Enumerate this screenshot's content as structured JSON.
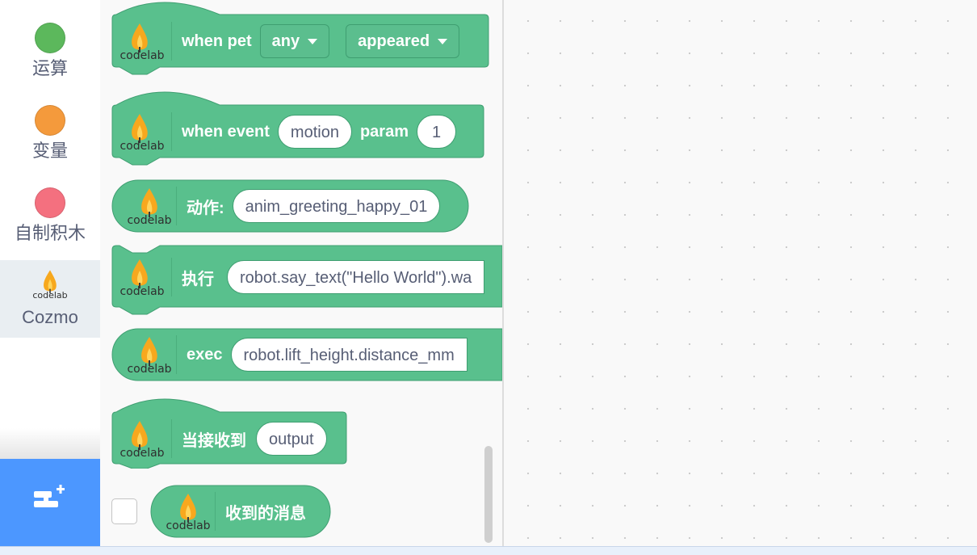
{
  "colors": {
    "block_green": "#59c08d",
    "block_border": "#3f9e71",
    "category_operators": "#5cb85c",
    "category_variables": "#f49a3c",
    "category_my_blocks": "#f4707f",
    "extension_button": "#4c97ff"
  },
  "sidebar": {
    "categories": [
      {
        "label": "运算",
        "icon": "green-circle-icon"
      },
      {
        "label": "变量",
        "icon": "orange-circle-icon"
      },
      {
        "label": "自制积木",
        "icon": "pink-circle-icon"
      },
      {
        "label": "Cozmo",
        "icon": "codelab-logo-icon",
        "selected": true
      }
    ],
    "extension_button_icon": "add-extension-icon"
  },
  "logo_text": "codelab",
  "blocks": {
    "when_pet": {
      "label": "when pet",
      "dropdown1": "any",
      "dropdown2": "appeared"
    },
    "when_event": {
      "label": "when event",
      "input1": "motion",
      "label2": "param",
      "input2": "1"
    },
    "action": {
      "label": "动作:",
      "input": "anim_greeting_happy_01"
    },
    "execute": {
      "label": "执行",
      "input": "robot.say_text(\"Hello World\").wa"
    },
    "exec": {
      "label": "exec",
      "input": "robot.lift_height.distance_mm"
    },
    "when_receive": {
      "label": "当接收到",
      "input": "output"
    },
    "received_message": {
      "label": "收到的消息"
    }
  }
}
